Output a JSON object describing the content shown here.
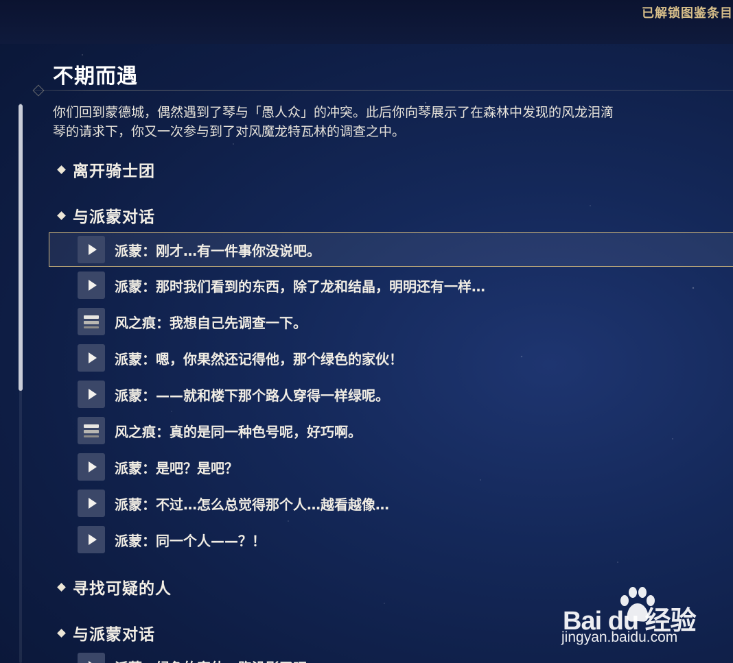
{
  "header": {
    "unlocked_label": "已解锁图鉴条目"
  },
  "quest": {
    "title": "不期而遇",
    "description": [
      "你们回到蒙德城，偶然遇到了琴与「愚人众」的冲突。此后你向琴展示了在森林中发现的风龙泪滴",
      "琴的请求下，你又一次参与到了对风魔龙特瓦林的调查之中。"
    ]
  },
  "sections": [
    {
      "label": "离开骑士团"
    },
    {
      "label": "与派蒙对话"
    },
    {
      "label": "寻找可疑的人"
    },
    {
      "label": "与派蒙对话"
    }
  ],
  "dialogue": [
    {
      "icon": "play-icon",
      "text": "派蒙：刚才…有一件事你没说吧。",
      "selected": true
    },
    {
      "icon": "play-icon",
      "text": "派蒙：那时我们看到的东西，除了龙和结晶，明明还有一样…"
    },
    {
      "icon": "text-stack-icon",
      "text": "风之痕：我想自己先调查一下。"
    },
    {
      "icon": "play-icon",
      "text": "派蒙：嗯，你果然还记得他，那个绿色的家伙！"
    },
    {
      "icon": "play-icon",
      "text": "派蒙：——就和楼下那个路人穿得一样绿呢。"
    },
    {
      "icon": "text-stack-icon",
      "text": "风之痕：真的是同一种色号呢，好巧啊。"
    },
    {
      "icon": "play-icon",
      "text": "派蒙：是吧？是吧？"
    },
    {
      "icon": "play-icon",
      "text": "派蒙：不过…怎么总觉得那个人…越看越像…"
    },
    {
      "icon": "play-icon",
      "text": "派蒙：同一个人——？！"
    }
  ],
  "cut_dialogue": {
    "icon": "play-icon",
    "text": "派蒙：绿色的家伙，跑没影了吧…"
  },
  "watermark": {
    "logo": "Bai du 经验",
    "url": "jingyan.baidu.com"
  },
  "colors": {
    "accent_border": "#d2b97e",
    "unlocked_text": "#d8bf8a",
    "icon_bg": "#3b4768"
  }
}
